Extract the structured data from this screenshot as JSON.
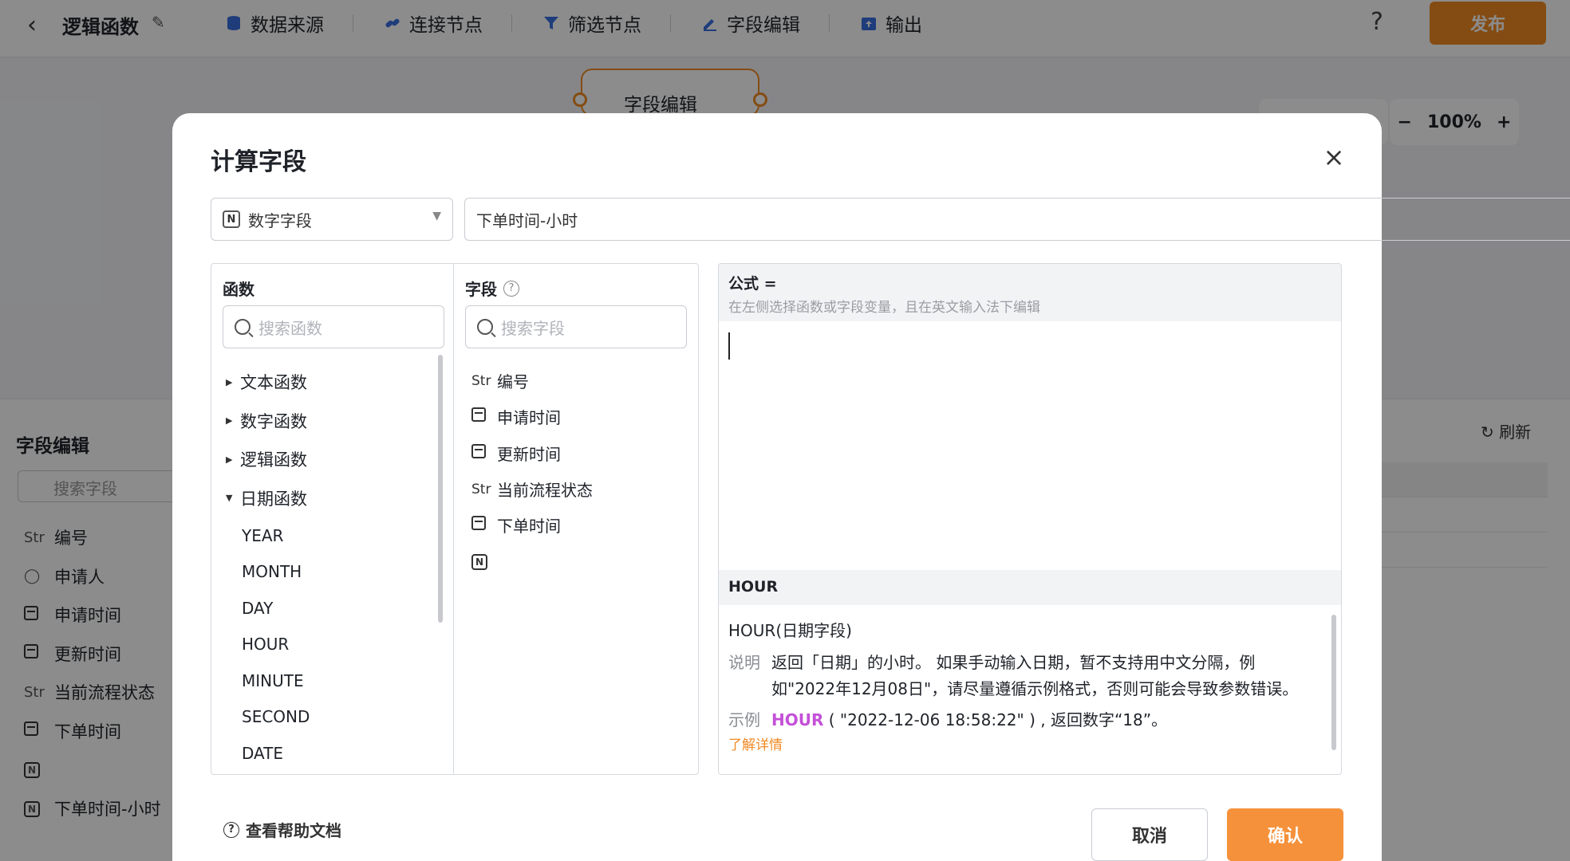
{
  "app": {
    "title": "逻辑函数",
    "tools": [
      {
        "label": "数据来源",
        "icon": "database-icon"
      },
      {
        "label": "连接节点",
        "icon": "link-icon"
      },
      {
        "label": "筛选节点",
        "icon": "filter-icon"
      },
      {
        "label": "字段编辑",
        "icon": "pen-icon"
      },
      {
        "label": "输出",
        "icon": "export-icon"
      }
    ],
    "help": "?",
    "publish": "发布",
    "canvas_node": "字段编辑",
    "zoom": "100%",
    "bottom_panel": {
      "title": "字段编辑",
      "search_placeholder": "搜索字段",
      "refresh": "刷新",
      "fields": [
        {
          "type": "Str",
          "label": "编号"
        },
        {
          "type": "person",
          "label": "申请人"
        },
        {
          "type": "date",
          "label": "申请时间"
        },
        {
          "type": "date",
          "label": "更新时间"
        },
        {
          "type": "Str",
          "label": "当前流程状态"
        },
        {
          "type": "date",
          "label": "下单时间"
        },
        {
          "type": "number",
          "label": ""
        },
        {
          "type": "number",
          "label": "下单时间-小时"
        }
      ]
    }
  },
  "modal": {
    "title": "计算字段",
    "close": "×",
    "type_select": {
      "label": "数字字段",
      "icon": "N"
    },
    "name_input": "下单时间-小时",
    "functions": {
      "title": "函数",
      "search_placeholder": "搜索函数",
      "categories": [
        {
          "label": "文本函数",
          "expanded": false
        },
        {
          "label": "数字函数",
          "expanded": false
        },
        {
          "label": "逻辑函数",
          "expanded": false
        },
        {
          "label": "日期函数",
          "expanded": true
        }
      ],
      "date_items": [
        "YEAR",
        "MONTH",
        "DAY",
        "HOUR",
        "MINUTE",
        "SECOND",
        "DATE"
      ]
    },
    "fields": {
      "title": "字段",
      "search_placeholder": "搜索字段",
      "items": [
        {
          "type": "Str",
          "label": "编号"
        },
        {
          "type": "date",
          "label": "申请时间"
        },
        {
          "type": "date",
          "label": "更新时间"
        },
        {
          "type": "Str",
          "label": "当前流程状态"
        },
        {
          "type": "date",
          "label": "下单时间"
        },
        {
          "type": "number",
          "label": ""
        }
      ]
    },
    "formula": {
      "label": "公式 =",
      "hint": "在左侧选择函数或字段变量，且在英文输入法下编辑"
    },
    "doc": {
      "name": "HOUR",
      "signature": "HOUR(日期字段)",
      "desc_key": "说明",
      "desc": "返回「日期」的小时。 如果手动输入日期，暂不支持用中文分隔，例如\"2022年12月08日\"，请尽量遵循示例格式，否则可能会导致参数错误。",
      "example_key": "示例",
      "example_fn": "HOUR",
      "example_rest": " ( \"2022-12-06 18:58:22\" ) , 返回数字“18”。",
      "learn_more": "了解详情"
    },
    "help_doc": "查看帮助文档",
    "cancel": "取消",
    "confirm": "确认"
  }
}
